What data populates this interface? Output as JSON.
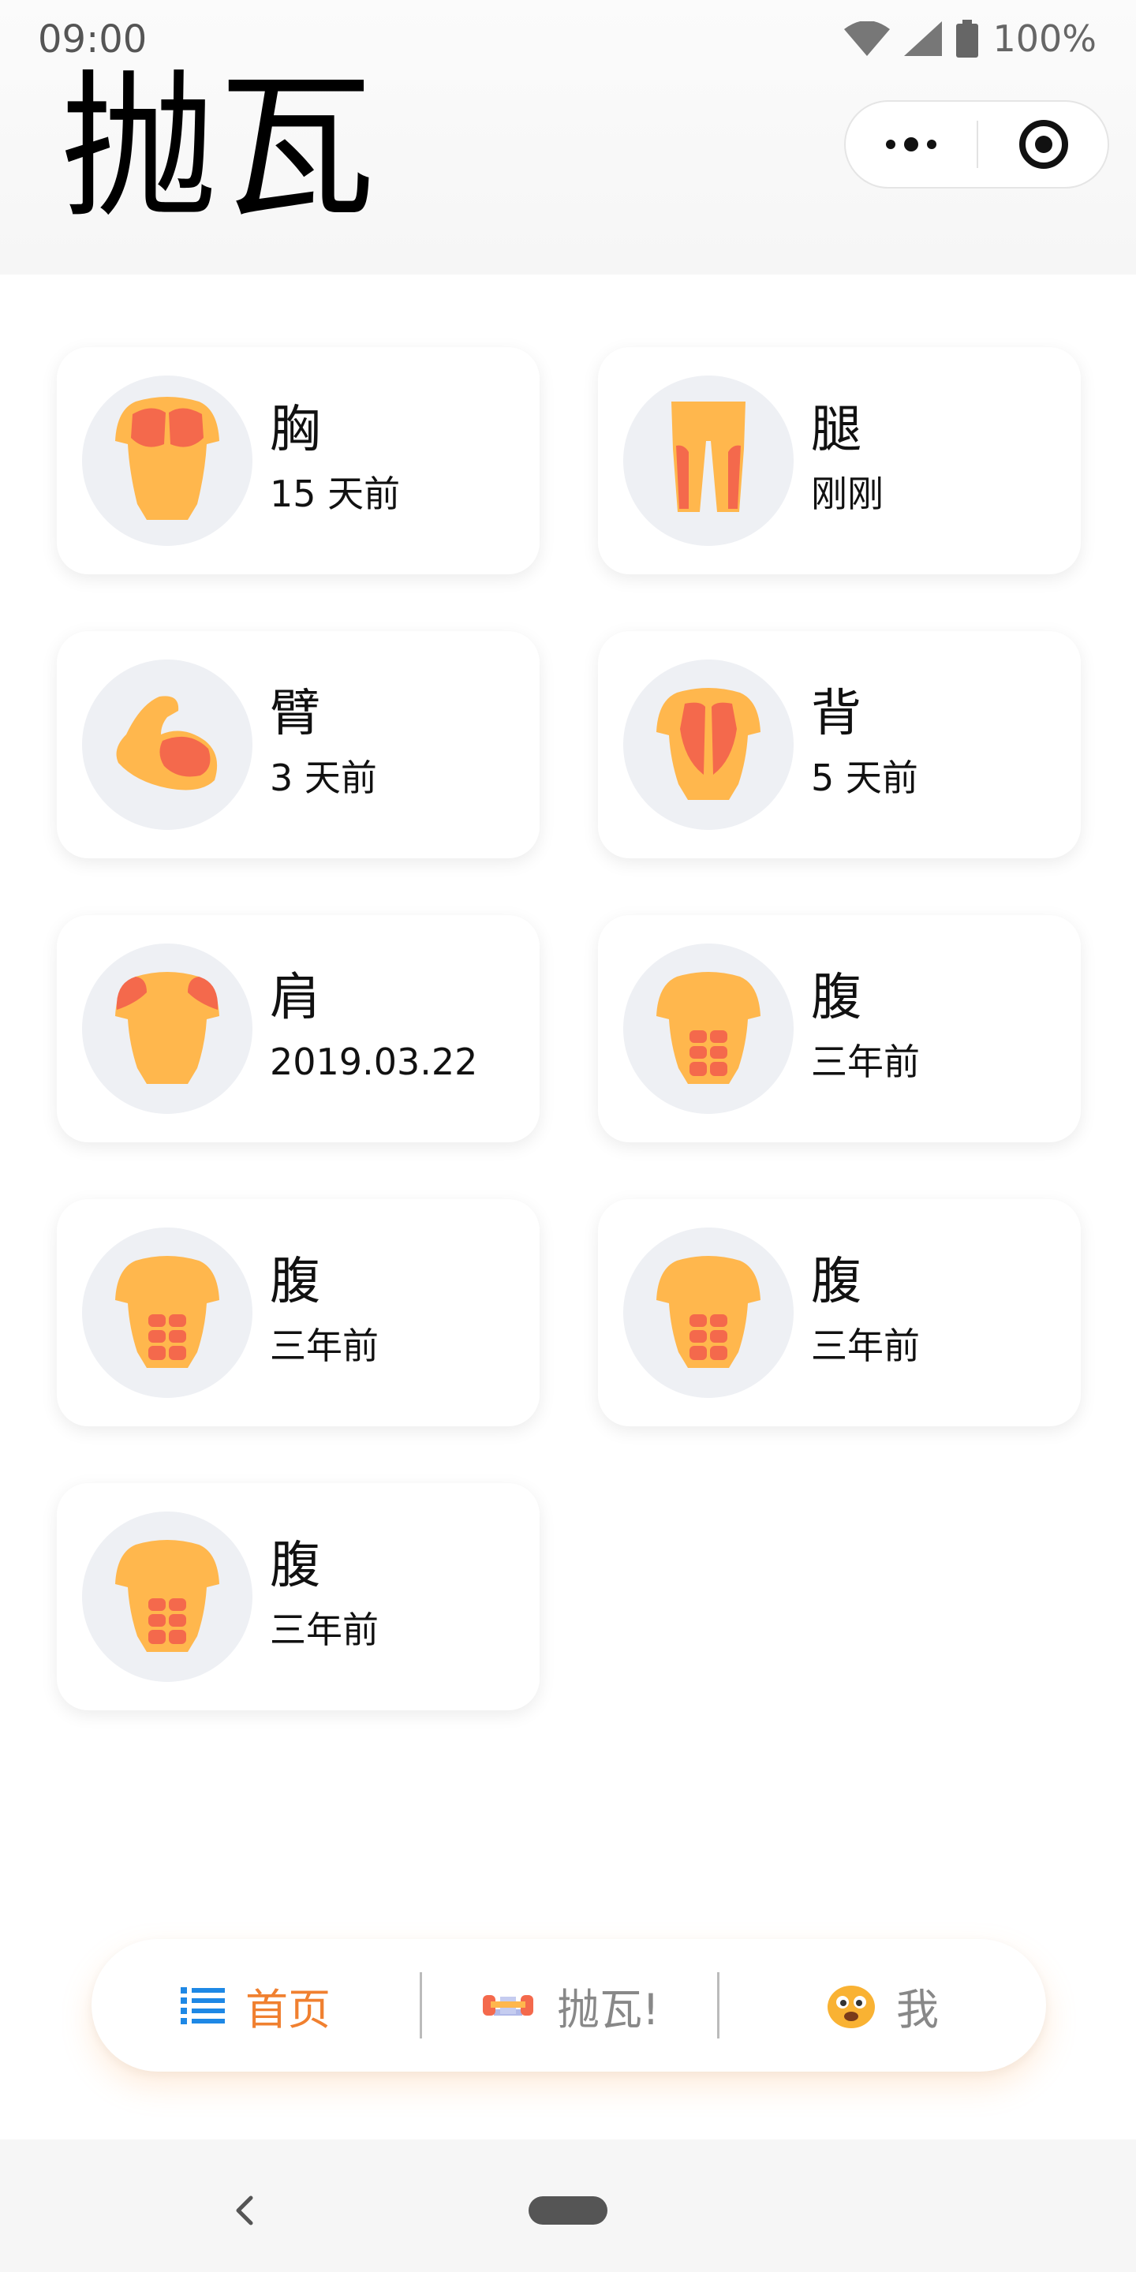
{
  "status_bar": {
    "time": "09:00",
    "battery": "100%"
  },
  "header": {
    "title": "抛瓦"
  },
  "cards": [
    {
      "name": "胸",
      "time": "15 天前",
      "icon": "chest-icon"
    },
    {
      "name": "腿",
      "time": "刚刚",
      "icon": "legs-icon"
    },
    {
      "name": "臂",
      "time": "3 天前",
      "icon": "arm-icon"
    },
    {
      "name": "背",
      "time": "5 天前",
      "icon": "back-icon"
    },
    {
      "name": "肩",
      "time": "2019.03.22",
      "icon": "shoulder-icon"
    },
    {
      "name": "腹",
      "time": "三年前",
      "icon": "abs-icon"
    },
    {
      "name": "腹",
      "time": "三年前",
      "icon": "abs-icon"
    },
    {
      "name": "腹",
      "time": "三年前",
      "icon": "abs-icon"
    },
    {
      "name": "腹",
      "time": "三年前",
      "icon": "abs-icon"
    }
  ],
  "tabbar": {
    "tabs": [
      {
        "label": "首页",
        "icon": "list-icon",
        "active": true
      },
      {
        "label": "抛瓦!",
        "icon": "dumbbell-icon",
        "active": false
      },
      {
        "label": "我",
        "icon": "emoji-face-icon",
        "active": false
      }
    ],
    "active_color": "#f08030",
    "inactive_color": "#888888"
  },
  "colors": {
    "skin": "#ffb74d",
    "muscle": "#f4694c",
    "avatar_bg": "#eef0f4"
  }
}
